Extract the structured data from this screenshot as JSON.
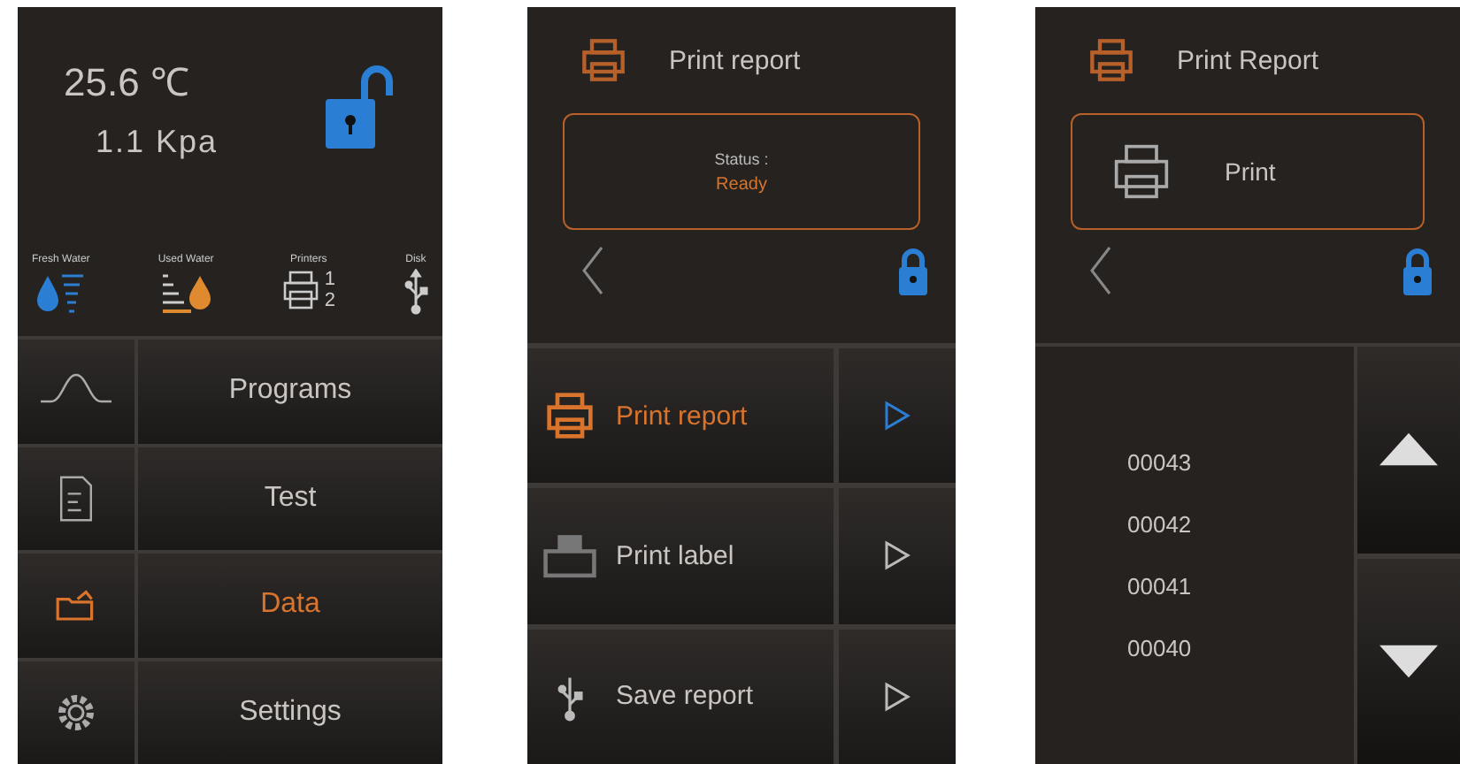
{
  "home": {
    "temperature": "25.6 ℃",
    "pressure": "1.1 Kpa",
    "locked": false,
    "indicators": [
      {
        "kind": "fresh",
        "label": "Fresh Water"
      },
      {
        "kind": "used",
        "label": "Used Water"
      },
      {
        "kind": "printers",
        "label": "Printers",
        "numbers": [
          "1",
          "2"
        ]
      },
      {
        "kind": "disk",
        "label": "Disk"
      }
    ],
    "menu": [
      {
        "kind": "wave",
        "label": "Programs",
        "selected": false
      },
      {
        "kind": "test",
        "label": "Test",
        "selected": false
      },
      {
        "kind": "folder",
        "label": "Data",
        "selected": true
      },
      {
        "kind": "gear",
        "label": "Settings",
        "selected": false
      }
    ]
  },
  "print_menu": {
    "title": "Print report",
    "status_label": "Status :",
    "status_value": "Ready",
    "locked": true,
    "actions": [
      {
        "kind": "printer",
        "label": "Print report",
        "selected": true
      },
      {
        "kind": "label-printer",
        "label": "Print label",
        "selected": false
      },
      {
        "kind": "usb",
        "label": "Save report",
        "selected": false
      }
    ]
  },
  "print_report": {
    "title": "Print Report",
    "print_button": "Print",
    "locked": true,
    "records": [
      "00043",
      "00042",
      "00041",
      "00040"
    ]
  }
}
